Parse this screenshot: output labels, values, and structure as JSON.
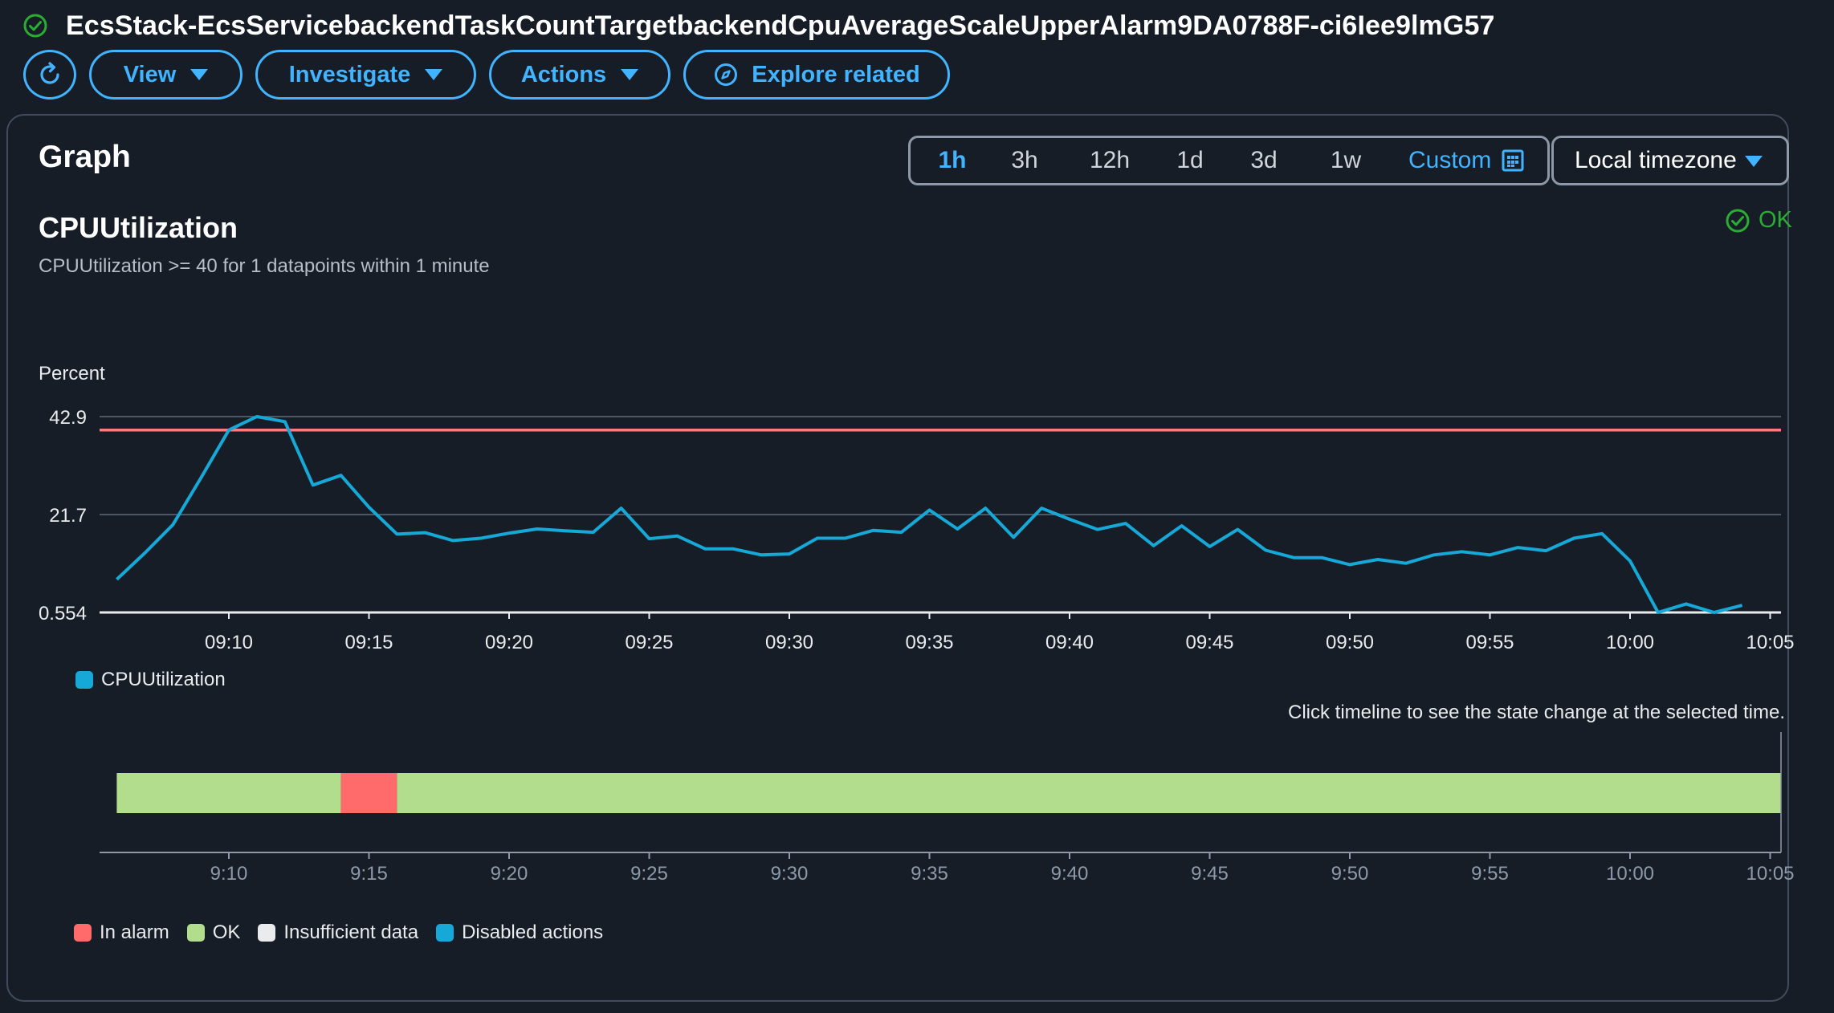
{
  "alarm": {
    "name": "EcsStack-EcsServicebackendTaskCountTargetbackendCpuAverageScaleUpperAlarm9DA0788F-ci6Iee9lmG57",
    "status_icon": "check-circle-icon"
  },
  "toolbar": {
    "refresh_icon": "refresh-icon",
    "view_label": "View",
    "investigate_label": "Investigate",
    "actions_label": "Actions",
    "explore_label": "Explore related",
    "accent": "#42b4ff"
  },
  "graph_panel": {
    "title": "Graph",
    "ranges": [
      "1h",
      "3h",
      "12h",
      "1d",
      "3d",
      "1w"
    ],
    "selected_range": "1h",
    "custom_label": "Custom",
    "timezone_label": "Local timezone"
  },
  "metric": {
    "title": "CPUUtilization",
    "condition": "CPUUtilization >= 40 for 1 datapoints within 1 minute",
    "state": "OK",
    "state_color": "#29ad32"
  },
  "chart_data": [
    {
      "type": "line",
      "ylabel": "Percent",
      "y_ticks": [
        "42.9",
        "21.7",
        "0.554"
      ],
      "y_tick_values": [
        42.9,
        21.7,
        0.554
      ],
      "ylim": [
        0.554,
        42.9
      ],
      "x_ticks": [
        "09:10",
        "09:15",
        "09:20",
        "09:25",
        "09:30",
        "09:35",
        "09:40",
        "09:45",
        "09:50",
        "09:55",
        "10:00",
        "10:05"
      ],
      "x_tick_minutes": [
        10,
        15,
        20,
        25,
        30,
        35,
        40,
        45,
        50,
        55,
        60,
        65
      ],
      "threshold": 40,
      "threshold_color": "#ff7a7a",
      "series": [
        {
          "name": "CPUUtilization",
          "color": "#16a8d7",
          "x_minutes": [
            6,
            7,
            8,
            9,
            10,
            11,
            12,
            13,
            14,
            15,
            16,
            17,
            18,
            19,
            20,
            21,
            22,
            23,
            24,
            25,
            26,
            27,
            28,
            29,
            30,
            31,
            32,
            33,
            34,
            35,
            36,
            37,
            38,
            39,
            40,
            41,
            42,
            43,
            44,
            45,
            46,
            47,
            48,
            49,
            50,
            51,
            52,
            53,
            54,
            55,
            56,
            57,
            58,
            59,
            60,
            61,
            62,
            63,
            64
          ],
          "values": [
            7.7,
            13.4,
            19.5,
            29.6,
            40.0,
            42.9,
            41.8,
            28.1,
            30.2,
            23.3,
            17.5,
            17.8,
            16.1,
            16.6,
            17.7,
            18.6,
            18.2,
            17.9,
            23.1,
            16.5,
            17.1,
            14.3,
            14.3,
            13.0,
            13.2,
            16.6,
            16.6,
            18.3,
            17.9,
            22.7,
            18.6,
            23.1,
            16.8,
            23.1,
            20.7,
            18.5,
            19.8,
            15.0,
            19.3,
            14.8,
            18.5,
            14.0,
            12.4,
            12.4,
            10.9,
            12.0,
            11.2,
            13.0,
            13.7,
            13.0,
            14.6,
            13.9,
            16.6,
            17.6,
            11.7,
            0.554,
            2.4,
            0.554,
            2.1
          ]
        }
      ]
    },
    {
      "type": "timeline",
      "x_ticks": [
        "9:10",
        "9:15",
        "9:20",
        "9:25",
        "9:30",
        "9:35",
        "9:40",
        "9:45",
        "9:50",
        "9:55",
        "10:00",
        "10:05"
      ],
      "x_tick_minutes": [
        10,
        15,
        20,
        25,
        30,
        35,
        40,
        45,
        50,
        55,
        60,
        65
      ],
      "segments": [
        {
          "state": "OK",
          "start": 6,
          "end": 14
        },
        {
          "state": "In alarm",
          "start": 14,
          "end": 16
        },
        {
          "state": "OK",
          "start": 16,
          "end": 70
        }
      ]
    }
  ],
  "legend": {
    "series_label": "CPUUtilization",
    "series_color": "#16a8d7"
  },
  "timeline": {
    "hint": "Click timeline to see the state change at the selected time.",
    "ok_color": "#b2dd8d",
    "alarm_color": "#ff6b6b",
    "insufficient_color": "#e9ebed",
    "disabled_color": "#16a8d7",
    "legend_items": [
      {
        "label": "In alarm",
        "color": "#ff6b6b"
      },
      {
        "label": "OK",
        "color": "#b2dd8d"
      },
      {
        "label": "Insufficient data",
        "color": "#e9ebed"
      },
      {
        "label": "Disabled actions",
        "color": "#16a8d7"
      }
    ]
  }
}
